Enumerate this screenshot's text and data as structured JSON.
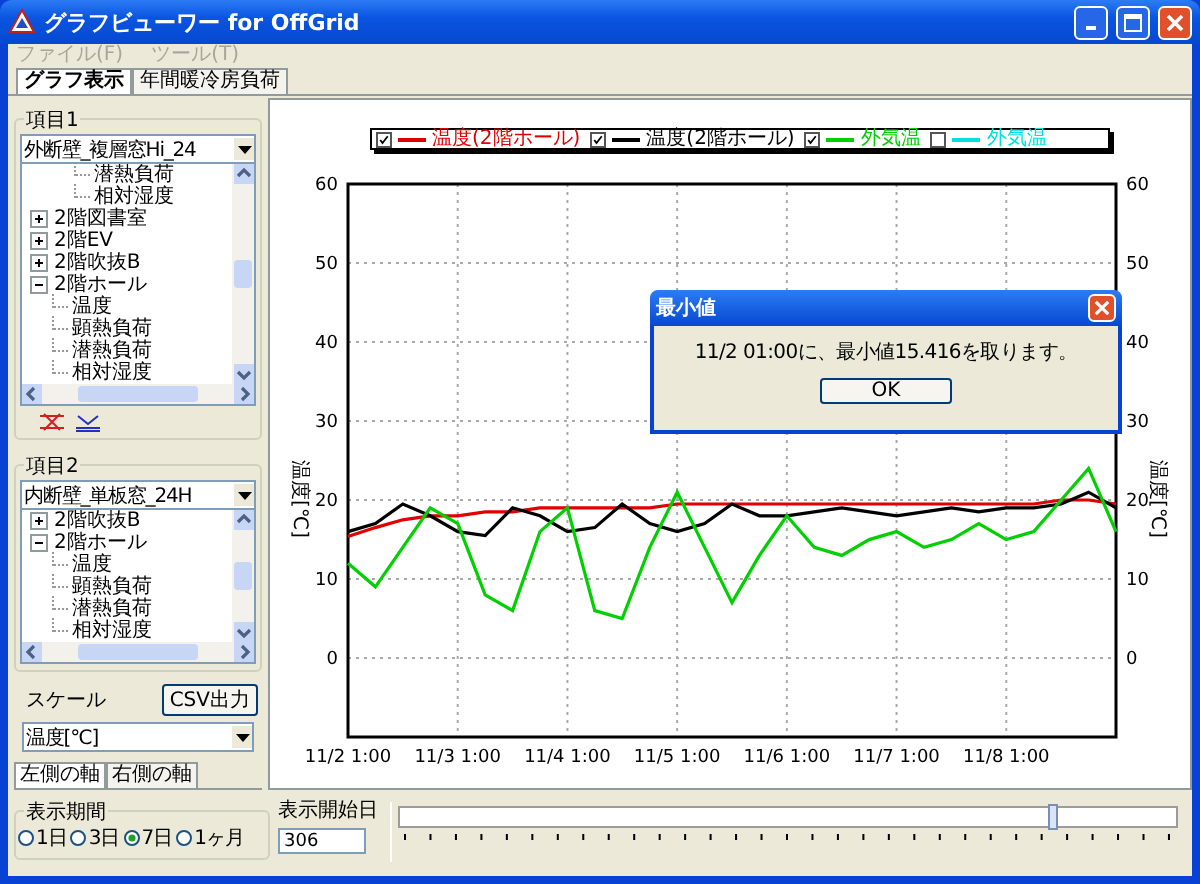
{
  "window": {
    "title": "グラフビューワー for OffGrid"
  },
  "menu": [
    {
      "label": "ファイル(F)",
      "disabled": true
    },
    {
      "label": "ツール(T)",
      "disabled": true
    }
  ],
  "tabs": [
    {
      "label": "グラフ表示",
      "selected": true
    },
    {
      "label": "年間暖冷房負荷",
      "selected": false
    }
  ],
  "item1": {
    "title": "項目1",
    "dropdown": "外断壁_複層窓Hi_24",
    "tree": [
      {
        "children": [
          {
            "label": "潜熱負荷"
          },
          {
            "label": "相対湿度"
          }
        ]
      },
      {
        "label": "2階図書室",
        "expanded": false
      },
      {
        "label": "2階EV",
        "expanded": false
      },
      {
        "label": "2階吹抜B",
        "expanded": false
      },
      {
        "label": "2階ホール",
        "expanded": true,
        "children": [
          {
            "label": "温度"
          },
          {
            "label": "顕熱負荷"
          },
          {
            "label": "潜熱負荷"
          },
          {
            "label": "相対湿度"
          }
        ]
      }
    ]
  },
  "item2": {
    "title": "項目2",
    "dropdown": "内断壁_単板窓_24H",
    "tree": [
      {
        "label": "2階吹抜B",
        "expanded": false
      },
      {
        "label": "2階ホール",
        "expanded": true,
        "children": [
          {
            "label": "温度"
          },
          {
            "label": "顕熱負荷"
          },
          {
            "label": "潜熱負荷"
          },
          {
            "label": "相対湿度"
          }
        ]
      }
    ]
  },
  "scale": {
    "label": "スケール",
    "csv_button": "CSV出力",
    "dropdown": "温度[℃]"
  },
  "axis_tabs": [
    {
      "label": "左側の軸",
      "selected": true
    },
    {
      "label": "右側の軸",
      "selected": false
    }
  ],
  "period": {
    "title": "表示期間",
    "options": [
      {
        "label": "1日",
        "selected": false
      },
      {
        "label": "3日",
        "selected": false
      },
      {
        "label": "7日",
        "selected": true
      },
      {
        "label": "1ヶ月",
        "selected": false
      }
    ]
  },
  "start_day": {
    "label": "表示開始日",
    "value": "306"
  },
  "slider": {
    "level": 0.84
  },
  "legend": [
    {
      "checked": true
    },
    {
      "checked": true
    },
    {
      "checked": true
    },
    {
      "label": "外気温",
      "color": "#00e0e0",
      "checked": false
    }
  ],
  "chart": {
    "right_axis": {
      "title": "温度[℃]",
      "ticks": [
        "60",
        "50",
        "40",
        "30",
        "20",
        "10",
        "0"
      ]
    },
    "chart_data": {
      "type": "line",
      "ylabel": "温度[℃]",
      "categories": [
        "11/2 1:00",
        null,
        null,
        null,
        "11/3 1:00",
        null,
        null,
        null,
        "11/4 1:00",
        null,
        null,
        null,
        "11/5 1:00",
        null,
        null,
        null,
        "11/6 1:00",
        null,
        null,
        null,
        "11/7 1:00",
        null,
        null,
        null,
        "11/8 1:00",
        null,
        null,
        null,
        null
      ],
      "ylim": [
        -10,
        60
      ],
      "grid": true,
      "yticks": [
        {
          "value": 60,
          "label": "60"
        },
        {
          "value": 50,
          "label": "50"
        },
        {
          "value": 40,
          "label": "40"
        },
        {
          "value": 30,
          "label": "30"
        },
        {
          "value": 20,
          "label": "20"
        },
        {
          "value": 10,
          "label": "10"
        },
        {
          "value": 0,
          "label": "0"
        }
      ],
      "series": [
        {
          "name": "温度(2階ホール)",
          "color": "#e00000",
          "values": [
            15.4,
            16.5,
            17.5,
            18,
            18,
            18.5,
            18.5,
            19,
            19,
            19,
            19,
            19,
            19.5,
            19.5,
            19.5,
            19.5,
            19.5,
            19.5,
            19.5,
            19.5,
            19.5,
            19.5,
            19.5,
            19.5,
            19.5,
            19.5,
            20,
            20,
            19.5
          ]
        },
        {
          "name": "温度(2階ホール)",
          "color": "#000000",
          "values": [
            16,
            17,
            19.5,
            18,
            16,
            15.5,
            19,
            18,
            16,
            16.5,
            19.5,
            17,
            16,
            17,
            19.5,
            18,
            18,
            18.5,
            19,
            18.5,
            18,
            18.5,
            19,
            18.5,
            19,
            19,
            19.5,
            21,
            19
          ]
        },
        {
          "name": "外気温",
          "color": "#00d000",
          "values": [
            12,
            9,
            14,
            19,
            17,
            8,
            6,
            16,
            19,
            6,
            5,
            14,
            21,
            14,
            7,
            13,
            18,
            14,
            13,
            15,
            16,
            14,
            15,
            17,
            15,
            16,
            20,
            24,
            16
          ]
        }
      ]
    }
  },
  "dialog": {
    "title": "最小値",
    "message": "11/2 01:00に、最小値15.416を取ります。",
    "button": "OK"
  }
}
